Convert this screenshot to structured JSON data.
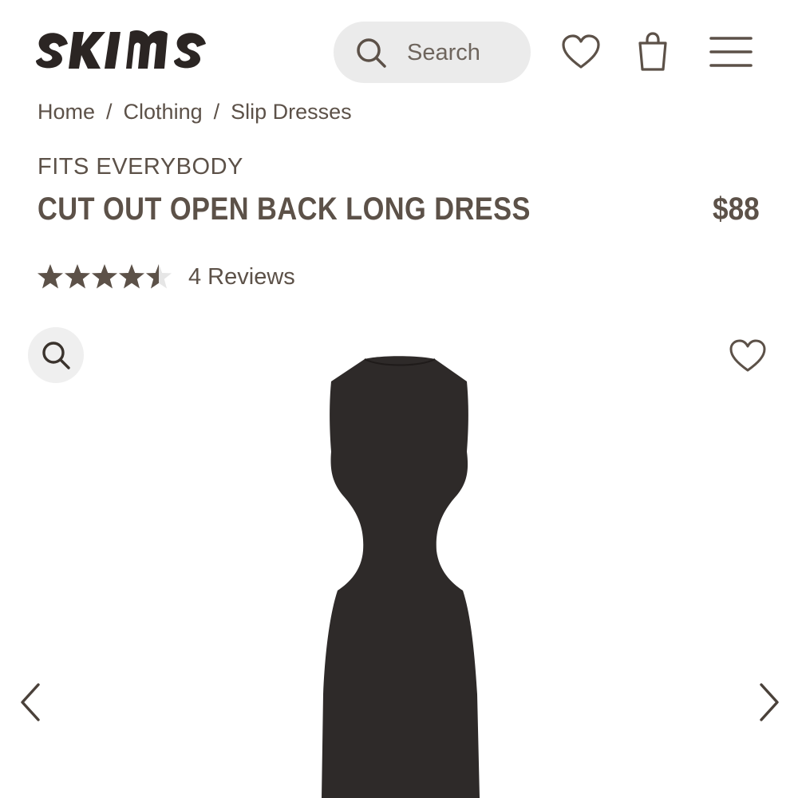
{
  "brand": {
    "logo_text": "SKIMS"
  },
  "header": {
    "search": {
      "placeholder": "Search",
      "icon": "search-icon"
    },
    "wishlist_icon": "heart-icon",
    "bag_icon": "shopping-bag-icon",
    "menu_icon": "hamburger-menu-icon"
  },
  "breadcrumb": {
    "items": [
      "Home",
      "Clothing",
      "Slip Dresses"
    ],
    "separator": "/"
  },
  "product": {
    "collection": "FITS EVERYBODY",
    "name": "CUT OUT OPEN BACK LONG DRESS",
    "price": "$88",
    "rating": {
      "value": 4.5,
      "max": 5,
      "reviews_label": "4 Reviews"
    }
  },
  "gallery": {
    "zoom_icon": "zoom-search-icon",
    "wishlist_icon": "heart-icon",
    "prev_icon": "chevron-left-icon",
    "next_icon": "chevron-right-icon"
  },
  "colors": {
    "text": "#5c5148",
    "logo": "#2b2523",
    "search_bg": "#ebebeb",
    "star_filled": "#5c5148",
    "star_empty": "#e6e6e6",
    "dress": "#2e2a29"
  }
}
